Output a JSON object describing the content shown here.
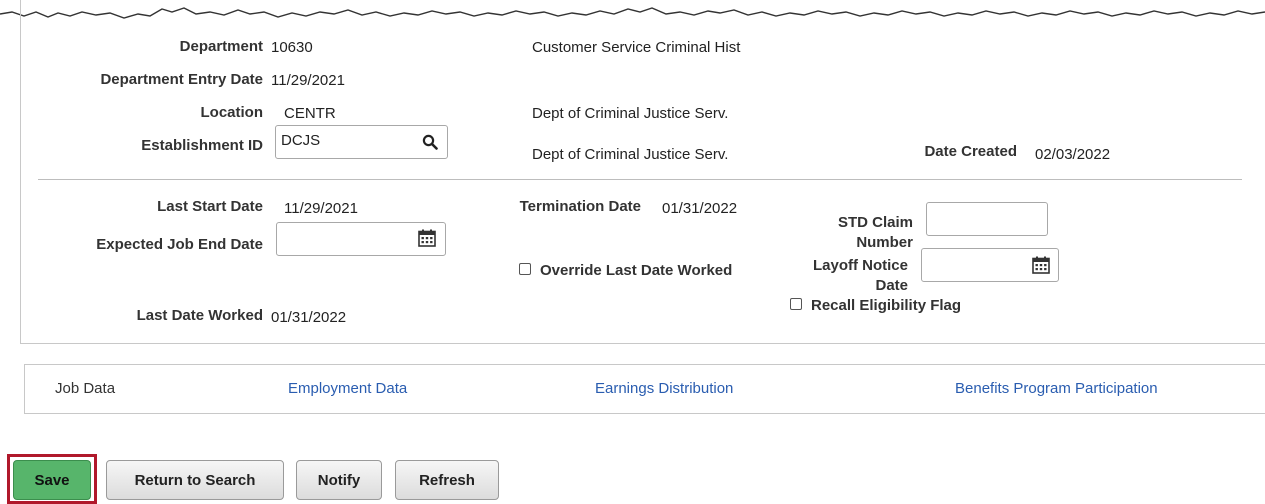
{
  "work_location": {
    "department": {
      "label": "Department",
      "code": "10630",
      "description": "Customer Service Criminal Hist"
    },
    "department_entry_date": {
      "label": "Department Entry Date",
      "value": "11/29/2021"
    },
    "location": {
      "label": "Location",
      "code": "CENTR",
      "description": "Dept of Criminal Justice Serv."
    },
    "establishment_id": {
      "label": "Establishment ID",
      "value": "DCJS",
      "description": "Dept of Criminal Justice Serv."
    },
    "date_created": {
      "label": "Date Created",
      "value": "02/03/2022"
    }
  },
  "dates": {
    "last_start_date": {
      "label": "Last Start Date",
      "value": "11/29/2021"
    },
    "expected_job_end_date": {
      "label": "Expected Job End Date",
      "value": ""
    },
    "last_date_worked": {
      "label": "Last Date Worked",
      "value": "01/31/2022"
    },
    "termination_date": {
      "label": "Termination Date",
      "value": "01/31/2022"
    },
    "override_last_date_worked": {
      "label": "Override Last Date Worked",
      "checked": false
    },
    "std_claim_number": {
      "label_line1": "STD Claim",
      "label_line2": "Number",
      "value": ""
    },
    "layoff_notice_date": {
      "label_line1": "Layoff Notice",
      "label_line2": "Date",
      "value": ""
    },
    "recall_eligibility_flag": {
      "label": "Recall Eligibility Flag",
      "checked": false
    }
  },
  "nav_links": {
    "job_data": "Job Data",
    "employment_data": "Employment Data",
    "earnings_distribution": "Earnings Distribution",
    "benefits_program_participation": "Benefits Program Participation"
  },
  "buttons": {
    "save": "Save",
    "return_to_search": "Return to Search",
    "notify": "Notify",
    "refresh": "Refresh"
  },
  "colors": {
    "link": "#2a5db0",
    "save_button": "#57b56b",
    "save_highlight": "#b0182b"
  },
  "icons": {
    "lookup": "search-icon",
    "calendar": "calendar-icon"
  }
}
